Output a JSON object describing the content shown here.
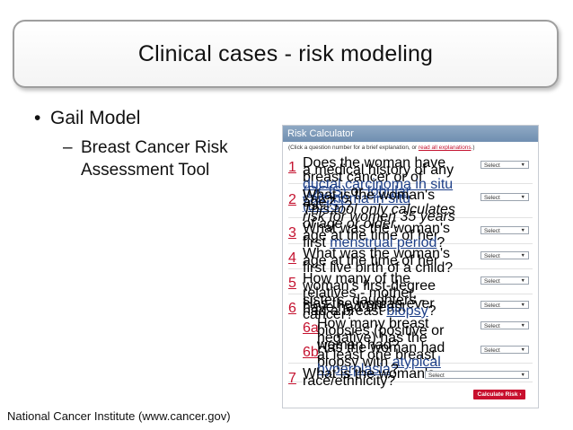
{
  "slide": {
    "title": "Clinical cases - risk modeling",
    "bullet1": "Gail Model",
    "bullet2": "Breast Cancer Risk Assessment Tool",
    "footer": "National Cancer Institute (www.cancer.gov)"
  },
  "calculator": {
    "header": "Risk Calculator",
    "hint_prefix": "(Click a question number for a brief explanation, or",
    "hint_link": "read all explanations",
    "hint_suffix": ".)",
    "questions": [
      {
        "num": "1",
        "text_a": "Does the woman have a medical history of any breast cancer or of ",
        "link1": "ductal carcinoma in situ (DCIS)",
        "text_b": " or ",
        "link2": "lobular carcinoma in situ (LCIS)",
        "text_c": "?",
        "select": "Select"
      },
      {
        "num": "2",
        "text": "What is the woman's age?",
        "note": "This tool only calculates risk for women 35 years of age or older.",
        "select": "Select"
      },
      {
        "num": "3",
        "text_a": "What was the woman's age at the time of her first ",
        "link1": "menstrual period",
        "text_c": "?",
        "select": "Select"
      },
      {
        "num": "4",
        "text": "What was the woman's age at the time of her first live birth of a child?",
        "select": "Select"
      },
      {
        "num": "5",
        "text": "How many of the woman's first-degree relatives - mother, sisters, daughters - have had breast cancer?",
        "select": "Select"
      },
      {
        "num": "6",
        "text_a": "Has the woman ever had a breast ",
        "link1": "biopsy",
        "text_c": "?",
        "select": "Select"
      },
      {
        "num": "6a",
        "text": "How many breast biopsies (positive or negative) has the woman had?",
        "select": "Select"
      },
      {
        "num": "6b",
        "text_a": "Has the woman had at least one breast biopsy with ",
        "link1": "atypical hyperplasia",
        "text_c": "?",
        "select": "Select"
      },
      {
        "num": "7",
        "text": "What is the woman's race/ethnicity?",
        "select": "Select"
      }
    ],
    "button": "Calculate Risk ›"
  }
}
